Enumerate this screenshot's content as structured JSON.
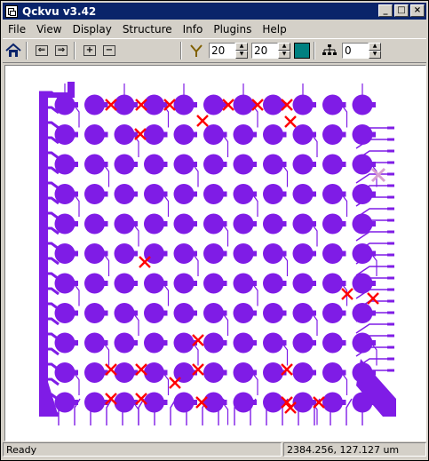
{
  "window": {
    "title": "Qckvu v3.42"
  },
  "menu": [
    "File",
    "View",
    "Display",
    "Structure",
    "Info",
    "Plugins",
    "Help"
  ],
  "toolbar": {
    "field1": "20",
    "field2": "20",
    "field3": "0"
  },
  "status": {
    "left": "Ready",
    "coords": "2384.256, 127.127 um"
  },
  "colors": {
    "layout": "#7f1ce6",
    "marker": "#ff0000",
    "marker_faded": "#d8a0d0",
    "title_bar": "#0a246a",
    "swatch": "#008080"
  },
  "icons": [
    "home-icon",
    "pan-left-icon",
    "pan-right-icon",
    "zoom-in-icon",
    "zoom-out-icon",
    "filter-icon",
    "hierarchy-icon"
  ]
}
